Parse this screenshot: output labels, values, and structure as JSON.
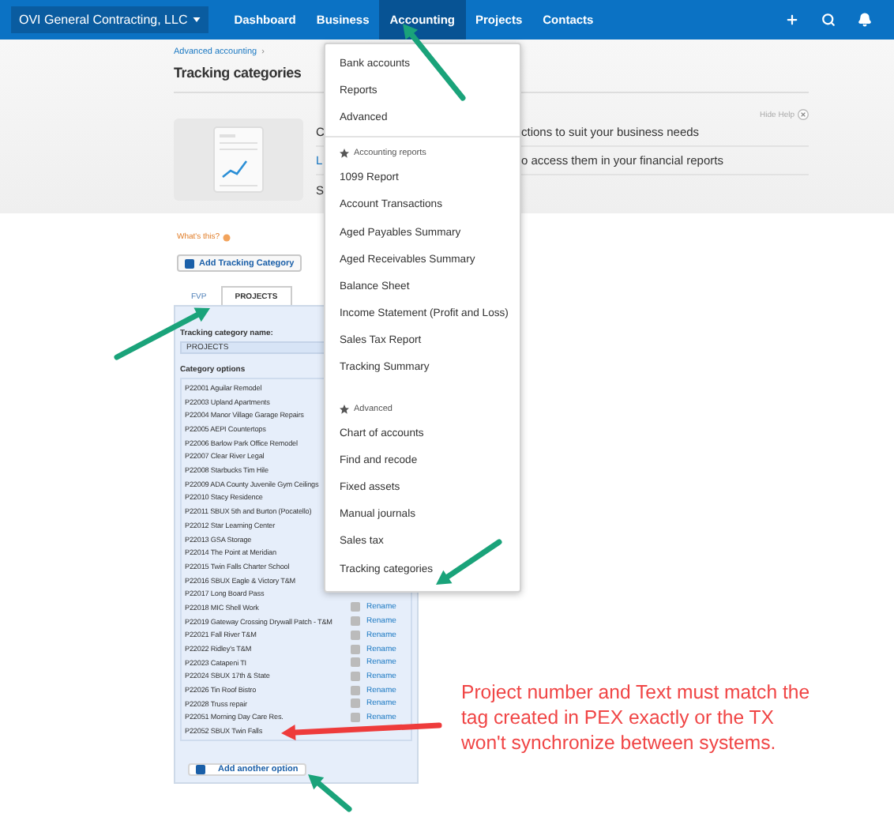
{
  "nav": {
    "org": "OVI General Contracting, LLC",
    "tabs": [
      {
        "label": "Dashboard",
        "selected": false
      },
      {
        "label": "Business",
        "selected": false
      },
      {
        "label": "Accounting",
        "selected": true
      },
      {
        "label": "Projects",
        "selected": false
      },
      {
        "label": "Contacts",
        "selected": false
      }
    ]
  },
  "header": {
    "breadcrumb": "Advanced accounting",
    "breadcrumb_sep": "›",
    "title": "Tracking categories",
    "hide_help": "Hide Help",
    "help_lines": [
      {
        "start": "C",
        "end": "ctions to suit your business needs",
        "link": false
      },
      {
        "start": "L",
        "end": "o access them in your financial reports",
        "link": true
      },
      {
        "start": "S",
        "link": false
      }
    ]
  },
  "whats_this": "What's this?",
  "add_category": "Add Tracking Category",
  "tabs": [
    {
      "label": "FVP",
      "selected": false
    },
    {
      "label": "PROJECTS",
      "selected": true
    }
  ],
  "panel": {
    "name_label": "Tracking category name:",
    "name_value": "PROJECTS",
    "options_label": "Category options",
    "options": [
      {
        "text": "P22001 Aguilar Remodel"
      },
      {
        "text": "P22003 Upland Apartments"
      },
      {
        "text": "P22004 Manor Village Garage Repairs"
      },
      {
        "text": "P22005 AEPI Countertops"
      },
      {
        "text": "P22006 Barlow Park Office Remodel"
      },
      {
        "text": "P22007 Clear River Legal"
      },
      {
        "text": "P22008 Starbucks Tim Hile"
      },
      {
        "text": "P22009 ADA County Juvenile Gym Ceilings"
      },
      {
        "text": "P22010 Stacy Residence"
      },
      {
        "text": "P22011 SBUX 5th and Burton (Pocatello)"
      },
      {
        "text": "P22012 Star Learning Center"
      },
      {
        "text": "P22013 GSA Storage"
      },
      {
        "text": "P22014 The Point at Meridian"
      },
      {
        "text": "P22015 Twin Falls Charter School"
      },
      {
        "text": "P22016 SBUX Eagle & Victory T&M"
      },
      {
        "text": "P22017 Long Board Pass"
      },
      {
        "text": "P22018 MIC Shell Work",
        "action": "Rename"
      },
      {
        "text": "P22019 Gateway Crossing Drywall Patch - T&M",
        "action": "Rename"
      },
      {
        "text": "P22021 Fall River T&M",
        "action": "Rename"
      },
      {
        "text": "P22022 Ridley's T&M",
        "action": "Rename"
      },
      {
        "text": "P22023 Catapeni TI",
        "action": "Rename"
      },
      {
        "text": "P22024 SBUX 17th & State",
        "action": "Rename"
      },
      {
        "text": "P22026 Tin Roof Bistro",
        "action": "Rename"
      },
      {
        "text": "P22028 Truss repair",
        "action": "Rename"
      },
      {
        "text": "P22051 Morning Day Care Res.",
        "action": "Rename"
      },
      {
        "text": "P22052 SBUX Twin Falls"
      }
    ],
    "add_option": "Add another option"
  },
  "menu": {
    "sections": [
      {
        "items": [
          "Bank accounts",
          "Reports",
          "Advanced"
        ]
      },
      {
        "heading": "Accounting reports",
        "items": [
          "1099 Report",
          "Account Transactions",
          "Aged Payables Summary",
          "Aged Receivables Summary",
          "Balance Sheet",
          "Income Statement (Profit and Loss)",
          "Sales Tax Report",
          "Tracking Summary"
        ]
      },
      {
        "heading": "Advanced",
        "items": [
          "Chart of accounts",
          "Find and recode",
          "Fixed assets",
          "Manual journals",
          "Sales tax",
          "Tracking categories"
        ]
      }
    ]
  },
  "note": "Project number and Text must match the tag created in PEX exactly or the TX won't synchronize between systems."
}
